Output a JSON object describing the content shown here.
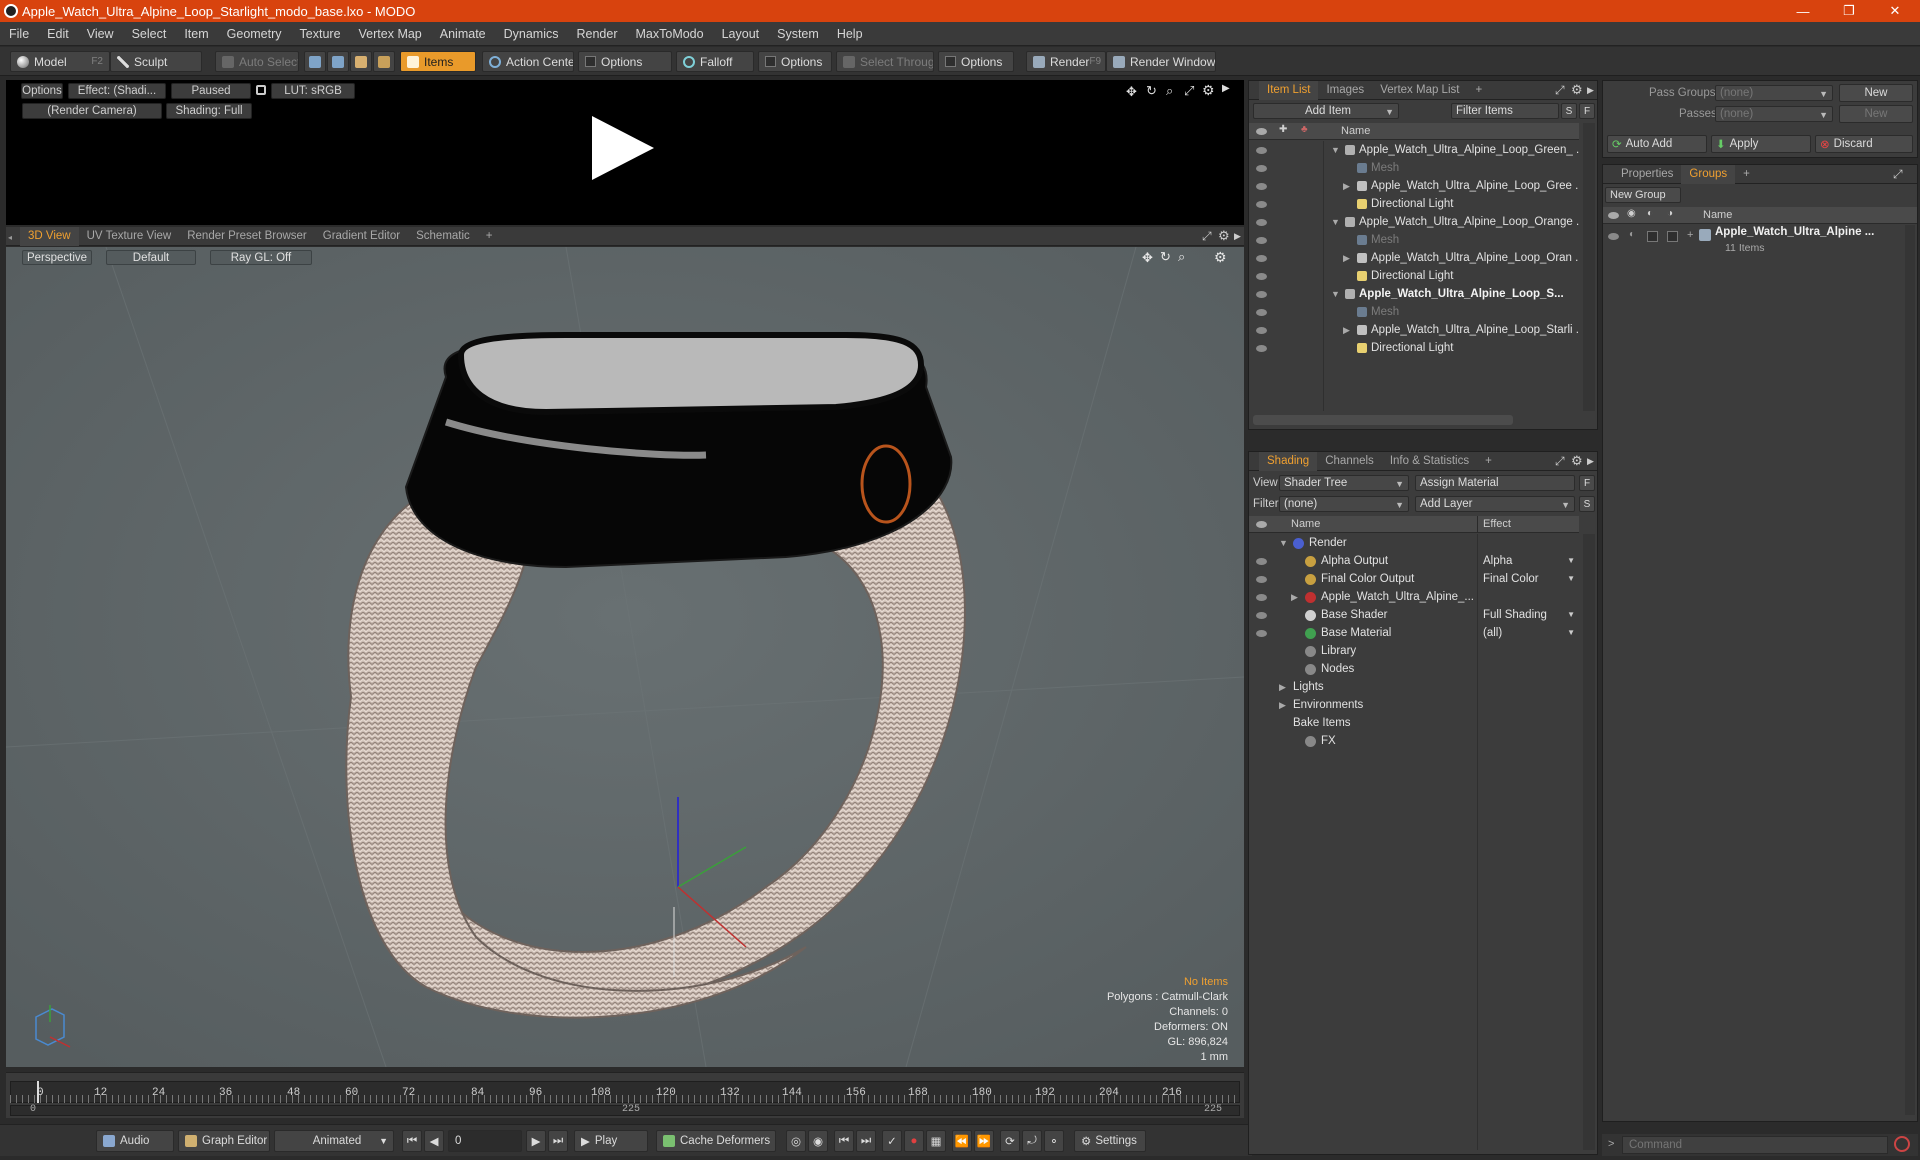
{
  "app": {
    "title": "Apple_Watch_Ultra_Alpine_Loop_Starlight_modo_base.lxo - MODO"
  },
  "window_controls": {
    "minimize": "—",
    "maximize": "❐",
    "close": "✕"
  },
  "menu": [
    "File",
    "Edit",
    "View",
    "Select",
    "Item",
    "Geometry",
    "Texture",
    "Vertex Map",
    "Animate",
    "Dynamics",
    "Render",
    "MaxToModo",
    "Layout",
    "System",
    "Help"
  ],
  "toolbar": {
    "model": "Model",
    "model_key": "F2",
    "sculpt": "Sculpt",
    "auto_select": "Auto Select",
    "items": "Items",
    "action_center": "Action Center",
    "options1": "Options",
    "falloff": "Falloff",
    "options2": "Options",
    "select_through": "Select Through",
    "options3": "Options",
    "render": "Render",
    "render_key": "F9",
    "render_window": "Render Window"
  },
  "render_preview": {
    "options": "Options",
    "effect": "Effect: (Shadi...",
    "paused": "Paused",
    "lut": "LUT: sRGB",
    "camera": "(Render Camera)",
    "shading": "Shading: Full"
  },
  "viewport_tabs": [
    "3D View",
    "UV Texture View",
    "Render Preset Browser",
    "Gradient Editor",
    "Schematic",
    "+"
  ],
  "viewport": {
    "perspective": "Perspective",
    "default": "Default",
    "raygl": "Ray GL: Off",
    "stats": {
      "no_items": "No Items",
      "polygons": "Polygons : Catmull-Clark",
      "channels": "Channels: 0",
      "deformers": "Deformers: ON",
      "gl": "GL: 896,824",
      "unit": "1 mm"
    }
  },
  "timeline": {
    "ticks": [
      "0",
      "12",
      "24",
      "36",
      "48",
      "60",
      "72",
      "84",
      "96",
      "108",
      "120",
      "132",
      "144",
      "156",
      "168",
      "180",
      "192",
      "204",
      "216"
    ],
    "bottom_labels": [
      "0",
      "225",
      "225"
    ]
  },
  "bottombar": {
    "audio": "Audio",
    "graph_editor": "Graph Editor",
    "animated": "Animated",
    "frame": "0",
    "play": "Play",
    "cache_deformers": "Cache Deformers",
    "settings": "Settings"
  },
  "item_list": {
    "tabs": [
      "Item List",
      "Images",
      "Vertex Map List",
      "+"
    ],
    "add_item": "Add Item",
    "filter_items": "Filter Items",
    "s": "S",
    "f": "F",
    "col_name": "Name",
    "rows": [
      {
        "text": "Apple_Watch_Ultra_Alpine_Loop_Green_ ...",
        "level": 0,
        "expand": "▼",
        "kind": "scene",
        "dim": false,
        "bold": false
      },
      {
        "text": "Mesh",
        "level": 1,
        "expand": "",
        "kind": "mesh",
        "dim": true,
        "bold": false
      },
      {
        "text": "Apple_Watch_Ultra_Alpine_Loop_Gree ...",
        "level": 1,
        "expand": "▶",
        "kind": "group",
        "dim": false,
        "bold": false
      },
      {
        "text": "Directional Light",
        "level": 1,
        "expand": "",
        "kind": "light",
        "dim": false,
        "bold": false
      },
      {
        "text": "Apple_Watch_Ultra_Alpine_Loop_Orange ...",
        "level": 0,
        "expand": "▼",
        "kind": "scene",
        "dim": false,
        "bold": false
      },
      {
        "text": "Mesh",
        "level": 1,
        "expand": "",
        "kind": "mesh",
        "dim": true,
        "bold": false
      },
      {
        "text": "Apple_Watch_Ultra_Alpine_Loop_Oran ...",
        "level": 1,
        "expand": "▶",
        "kind": "group",
        "dim": false,
        "bold": false
      },
      {
        "text": "Directional Light",
        "level": 1,
        "expand": "",
        "kind": "light",
        "dim": false,
        "bold": false
      },
      {
        "text": "Apple_Watch_Ultra_Alpine_Loop_S...",
        "level": 0,
        "expand": "▼",
        "kind": "scene",
        "dim": false,
        "bold": true
      },
      {
        "text": "Mesh",
        "level": 1,
        "expand": "",
        "kind": "mesh",
        "dim": true,
        "bold": false
      },
      {
        "text": "Apple_Watch_Ultra_Alpine_Loop_Starli ...",
        "level": 1,
        "expand": "▶",
        "kind": "group",
        "dim": false,
        "bold": false
      },
      {
        "text": "Directional Light",
        "level": 1,
        "expand": "",
        "kind": "light",
        "dim": false,
        "bold": false
      }
    ]
  },
  "shading": {
    "tabs": [
      "Shading",
      "Channels",
      "Info & Statistics",
      "+"
    ],
    "view_label": "View",
    "view_value": "Shader Tree",
    "assign_material": "Assign Material",
    "f": "F",
    "filter_label": "Filter",
    "filter_value": "(none)",
    "add_layer": "Add Layer",
    "s": "S",
    "col_name": "Name",
    "col_effect": "Effect",
    "rows": [
      {
        "text": "Render",
        "effect": "",
        "level": 0,
        "expand": "▼",
        "icon": "#4a5fd0",
        "eye": false
      },
      {
        "text": "Alpha Output",
        "effect": "Alpha",
        "level": 1,
        "expand": "",
        "icon": "#c8a040",
        "eye": true
      },
      {
        "text": "Final Color Output",
        "effect": "Final Color",
        "level": 1,
        "expand": "",
        "icon": "#c8a040",
        "eye": true
      },
      {
        "text": "Apple_Watch_Ultra_Alpine_...",
        "effect": "",
        "level": 1,
        "expand": "▶",
        "icon": "#c03030",
        "eye": true
      },
      {
        "text": "Base Shader",
        "effect": "Full Shading",
        "level": 1,
        "expand": "",
        "icon": "#d0d0d0",
        "eye": true
      },
      {
        "text": "Base Material",
        "effect": "(all)",
        "level": 1,
        "expand": "",
        "icon": "#40a050",
        "eye": true
      },
      {
        "text": "Library",
        "effect": "",
        "level": 1,
        "expand": "",
        "icon": "#888888",
        "eye": false
      },
      {
        "text": "Nodes",
        "effect": "",
        "level": 1,
        "expand": "",
        "icon": "#888888",
        "eye": false
      },
      {
        "text": "Lights",
        "effect": "",
        "level": 0,
        "expand": "▶",
        "icon": "",
        "eye": false
      },
      {
        "text": "Environments",
        "effect": "",
        "level": 0,
        "expand": "▶",
        "icon": "",
        "eye": false
      },
      {
        "text": "Bake Items",
        "effect": "",
        "level": 0,
        "expand": "",
        "icon": "",
        "eye": false
      },
      {
        "text": "FX",
        "effect": "",
        "level": 1,
        "expand": "",
        "icon": "#888888",
        "eye": false
      }
    ]
  },
  "pass_groups": {
    "pass_groups_label": "Pass Groups",
    "pass_groups_value": "(none)",
    "new1": "New",
    "passes_label": "Passes",
    "passes_value": "(none)",
    "new2": "New",
    "auto_add": "Auto Add",
    "apply": "Apply",
    "discard": "Discard"
  },
  "groups": {
    "tabs": [
      "Properties",
      "Groups",
      "+"
    ],
    "new_group": "New Group",
    "col_name": "Name",
    "item_name": "Apple_Watch_Ultra_Alpine ...",
    "item_count": "11 Items"
  },
  "command": {
    "placeholder": "Command",
    "prompt": ">"
  },
  "colors": {
    "accent": "#f0a030",
    "titlebar": "#d8430e",
    "viewport_bg": "#5f6769"
  }
}
